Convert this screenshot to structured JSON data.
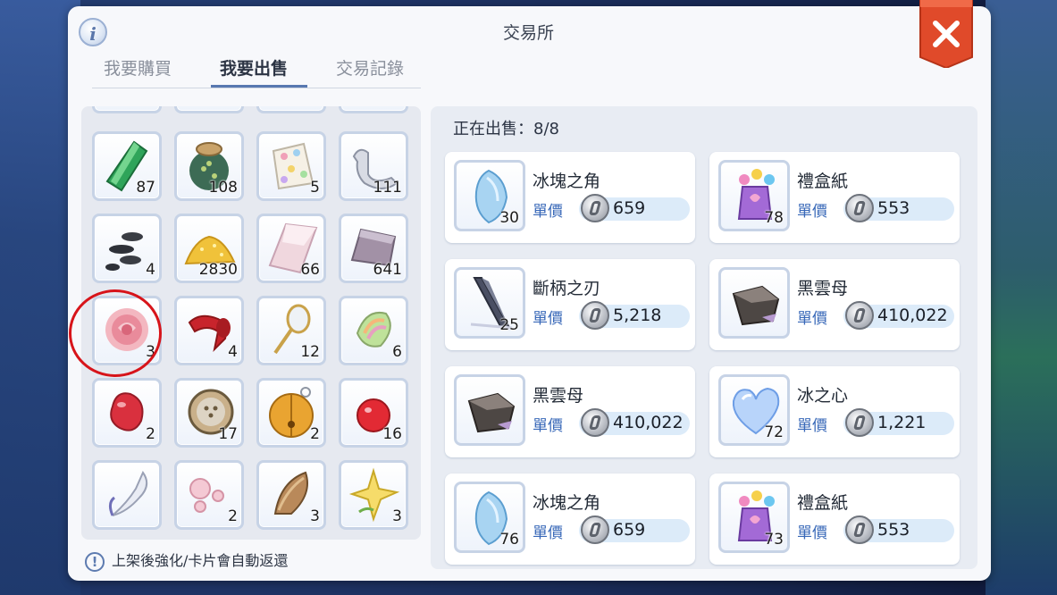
{
  "window": {
    "title": "交易所"
  },
  "tabs": [
    {
      "label": "我要購買",
      "active": false
    },
    {
      "label": "我要出售",
      "active": true
    },
    {
      "label": "交易記錄",
      "active": false
    }
  ],
  "inventory": {
    "rows": [
      [
        {
          "icon": "green-crystal-icon",
          "count": "87"
        },
        {
          "icon": "peacock-feather-pouch-icon",
          "count": "108"
        },
        {
          "icon": "polka-dot-cloth-icon",
          "count": "5"
        },
        {
          "icon": "bone-icon",
          "count": "111"
        }
      ],
      [
        {
          "icon": "dark-stones-icon",
          "count": "4"
        },
        {
          "icon": "gold-powder-icon",
          "count": "2830"
        },
        {
          "icon": "crystal-shard-icon",
          "count": "66"
        },
        {
          "icon": "mica-slab-icon",
          "count": "641"
        }
      ],
      [
        {
          "icon": "pink-rose-icon",
          "count": "3",
          "highlighted": true
        },
        {
          "icon": "red-ribbon-icon",
          "count": "4"
        },
        {
          "icon": "hand-mirror-icon",
          "count": "12"
        },
        {
          "icon": "rainbow-shell-icon",
          "count": "6"
        }
      ],
      [
        {
          "icon": "red-gem-icon",
          "count": "2"
        },
        {
          "icon": "button-icon",
          "count": "17"
        },
        {
          "icon": "golden-bell-icon",
          "count": "2"
        },
        {
          "icon": "red-apple-icon",
          "count": "16"
        }
      ],
      [
        {
          "icon": "white-feather-icon",
          "count": ""
        },
        {
          "icon": "pink-pearls-icon",
          "count": "2"
        },
        {
          "icon": "brown-shell-icon",
          "count": "3"
        },
        {
          "icon": "yellow-crystal-flower-icon",
          "count": "3"
        }
      ]
    ]
  },
  "notice": "上架後強化/卡片會自動返還",
  "listing": {
    "header": "正在出售：8/8",
    "unit_label": "單價",
    "cards": [
      {
        "name": "冰塊之角",
        "count": "30",
        "price": "659",
        "icon": "ice-horn-icon"
      },
      {
        "name": "禮盒紙",
        "count": "78",
        "price": "553",
        "icon": "gift-wrap-icon"
      },
      {
        "name": "斷柄之刃",
        "count": "25",
        "price": "5,218",
        "icon": "broken-blade-icon"
      },
      {
        "name": "黑雲母",
        "count": "",
        "price": "410,022",
        "icon": "black-mica-icon"
      },
      {
        "name": "黑雲母",
        "count": "",
        "price": "410,022",
        "icon": "black-mica-icon"
      },
      {
        "name": "冰之心",
        "count": "72",
        "price": "1,221",
        "icon": "ice-heart-icon"
      },
      {
        "name": "冰塊之角",
        "count": "76",
        "price": "659",
        "icon": "ice-horn-icon"
      },
      {
        "name": "禮盒紙",
        "count": "73",
        "price": "553",
        "icon": "gift-wrap-icon"
      }
    ]
  },
  "colors": {
    "accent": "#5878b0",
    "close": "#e04a2a",
    "price_text": "#3868b8"
  }
}
